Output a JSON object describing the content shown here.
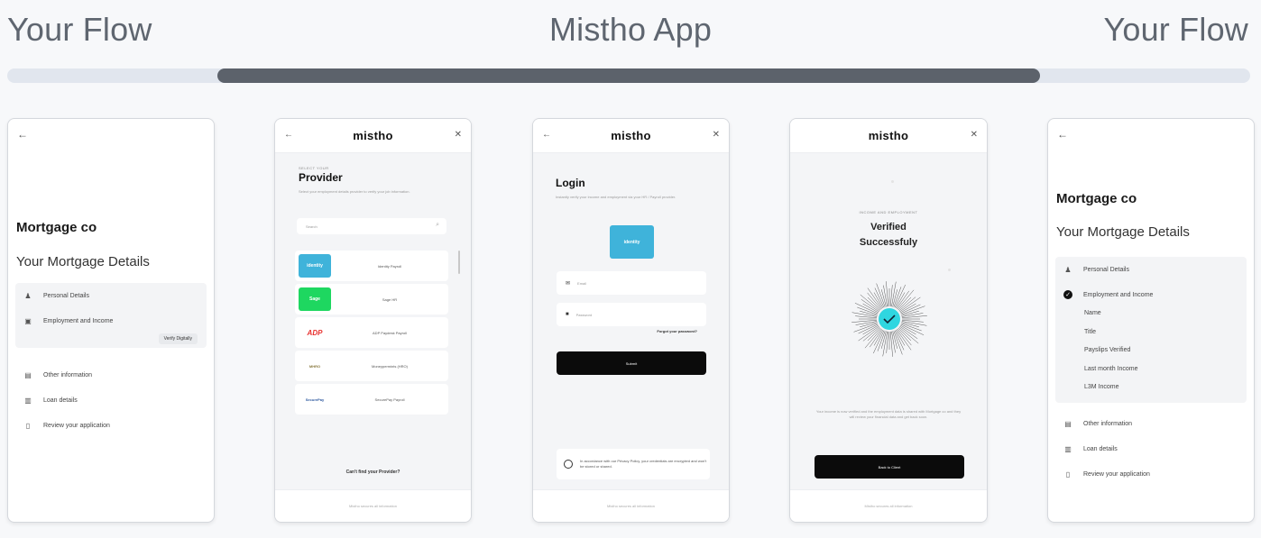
{
  "header": {
    "left": "Your Flow",
    "center": "Mistho App",
    "right": "Your Flow"
  },
  "progress": {
    "start_fraction": 0.17,
    "end_fraction": 0.835
  },
  "colors": {
    "track": "#e1e6ee",
    "track_fill": "#5c626b",
    "login_logo": "#3fb3da",
    "verified_check": "#2fd6e0",
    "button": "#0b0b0b"
  },
  "screen1": {
    "company": "Mortgage co",
    "subtitle": "Your Mortgage Details",
    "items": [
      {
        "label": "Personal Details",
        "icon": "person-icon"
      },
      {
        "label": "Employment and Income",
        "icon": "briefcase-icon"
      },
      {
        "label": "Other information",
        "icon": "document-icon"
      },
      {
        "label": "Loan details",
        "icon": "bank-icon"
      },
      {
        "label": "Review your application",
        "icon": "phone-icon"
      }
    ],
    "verify_button": "Verify Digitally"
  },
  "screen2": {
    "logo": "mistho",
    "caption": "Select your",
    "title": "Provider",
    "description": "Select your employment details provider to verify your job information.",
    "search_placeholder": "Search",
    "providers": [
      {
        "name": "Identity Payroll",
        "logo_text": "identity",
        "color": "#3fb3da"
      },
      {
        "name": "Sage HR",
        "logo_text": "Sage",
        "color": "#1ed760"
      },
      {
        "name": "ADP Paydesk Payroll",
        "logo_text": "ADP",
        "color": "#e8302e"
      },
      {
        "name": "Moneypermints (HRO)",
        "logo_text": "MHRO",
        "color": "#c9b070"
      },
      {
        "name": "SecurePay Payroll",
        "logo_text": "SecurePay",
        "color": "#2f5aa0"
      }
    ],
    "cant_find": "Can't find your Provider?",
    "footer": "Mistho secures all information"
  },
  "screen3": {
    "logo": "mistho",
    "title": "Login",
    "description": "Instantly verify your income and employment via your HR / Payroll provider.",
    "provider_logo_text": "identity",
    "email_placeholder": "Email",
    "password_placeholder": "Password",
    "forgot": "Forgot your password?",
    "submit": "Submit",
    "consent": "In accordance with our Privacy Policy, your credentials are encrypted and won't be stored or shared.",
    "footer": "Mistho secures all information"
  },
  "screen4": {
    "logo": "mistho",
    "caption": "Income and employment",
    "title_line1": "Verified",
    "title_line2": "Successfuly",
    "description": "Your income is now verified and the employment data is shared with Mortgage co and they will review your financial data and get back soon.",
    "button": "Back to Client",
    "footer": "Mistho secures all information"
  },
  "screen5": {
    "company": "Mortgage co",
    "subtitle": "Your Mortgage Details",
    "items": [
      {
        "label": "Personal Details",
        "icon": "person-icon"
      },
      {
        "label": "Employment and Income",
        "icon": "check-circle-icon"
      }
    ],
    "verified_fields": [
      "Name",
      "Title",
      "Payslips Verified",
      "Last month Income",
      "L3M Income"
    ],
    "more_items": [
      {
        "label": "Other information",
        "icon": "document-icon"
      },
      {
        "label": "Loan details",
        "icon": "bank-icon"
      },
      {
        "label": "Review your application",
        "icon": "phone-icon"
      }
    ]
  }
}
